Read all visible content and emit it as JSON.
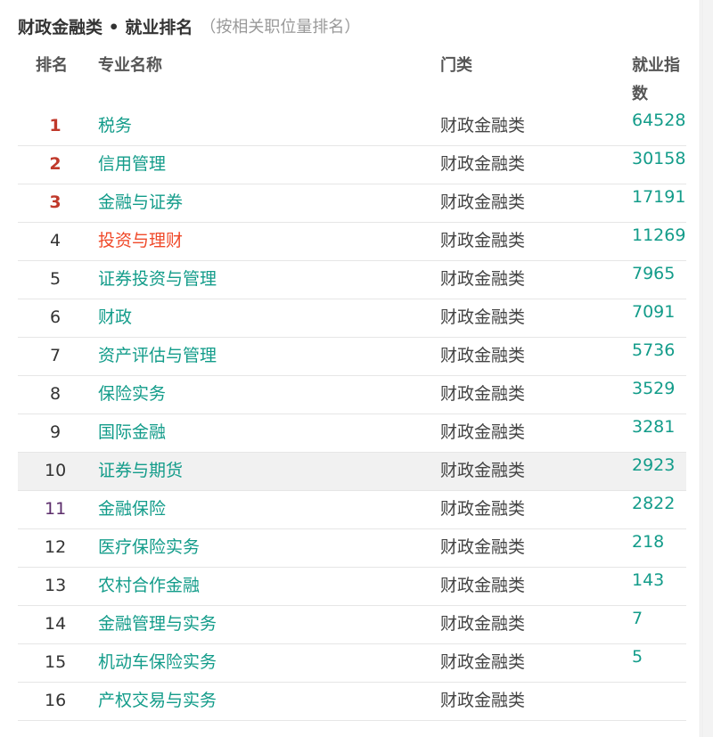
{
  "header": {
    "title": "财政金融类 • 就业排名",
    "subtitle": "（按相关职位量排名）"
  },
  "columns": {
    "rank": "排名",
    "name": "专业名称",
    "category": "门类",
    "index": "就业指数"
  },
  "rows": [
    {
      "rank": "1",
      "name": "税务",
      "category": "财政金融类",
      "index": "64528"
    },
    {
      "rank": "2",
      "name": "信用管理",
      "category": "财政金融类",
      "index": "30158"
    },
    {
      "rank": "3",
      "name": "金融与证券",
      "category": "财政金融类",
      "index": "17191"
    },
    {
      "rank": "4",
      "name": "投资与理财",
      "category": "财政金融类",
      "index": "11269"
    },
    {
      "rank": "5",
      "name": "证券投资与管理",
      "category": "财政金融类",
      "index": "7965"
    },
    {
      "rank": "6",
      "name": "财政",
      "category": "财政金融类",
      "index": "7091"
    },
    {
      "rank": "7",
      "name": "资产评估与管理",
      "category": "财政金融类",
      "index": "5736"
    },
    {
      "rank": "8",
      "name": "保险实务",
      "category": "财政金融类",
      "index": "3529"
    },
    {
      "rank": "9",
      "name": "国际金融",
      "category": "财政金融类",
      "index": "3281"
    },
    {
      "rank": "10",
      "name": "证券与期货",
      "category": "财政金融类",
      "index": "2923"
    },
    {
      "rank": "11",
      "name": "金融保险",
      "category": "财政金融类",
      "index": "2822"
    },
    {
      "rank": "12",
      "name": "医疗保险实务",
      "category": "财政金融类",
      "index": "218"
    },
    {
      "rank": "13",
      "name": "农村合作金融",
      "category": "财政金融类",
      "index": "143"
    },
    {
      "rank": "14",
      "name": "金融管理与实务",
      "category": "财政金融类",
      "index": "7"
    },
    {
      "rank": "15",
      "name": "机动车保险实务",
      "category": "财政金融类",
      "index": "5"
    },
    {
      "rank": "16",
      "name": "产权交易与实务",
      "category": "财政金融类",
      "index": ""
    }
  ],
  "colors": {
    "link": "#139c8a",
    "highlight_link": "#f04a2a",
    "top_rank": "#c0392b",
    "row_hover_bg": "#f1f1f1"
  }
}
